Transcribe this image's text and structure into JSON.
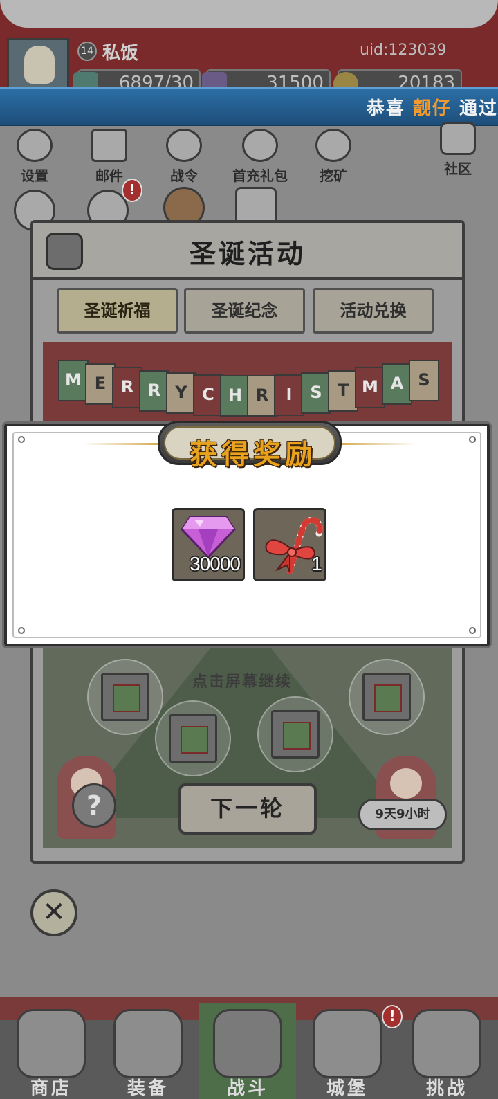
{
  "player": {
    "level": "14",
    "name": "私饭",
    "uid": "uid:123039"
  },
  "resources": [
    {
      "icon": "green-gem-icon",
      "value": "6897/30"
    },
    {
      "icon": "purple-diamond-icon",
      "value": "31500"
    },
    {
      "icon": "gold-coin-icon",
      "value": "20183"
    }
  ],
  "marquee": {
    "prefix": "恭喜",
    "highlight": "靓仔",
    "suffix": "通过",
    "highlight_color": "#f29a2e"
  },
  "top_icons": [
    {
      "icon": "gear-icon",
      "label": "设置"
    },
    {
      "icon": "mail-icon",
      "label": "邮件"
    },
    {
      "icon": "war-order-icon",
      "label": "战令"
    },
    {
      "icon": "first-recharge-gift-icon",
      "label": "首充礼包"
    },
    {
      "icon": "mining-icon",
      "label": "挖矿"
    },
    {
      "icon": "home-icon",
      "label": "社区"
    }
  ],
  "event": {
    "title": "圣诞活动",
    "tabs": [
      {
        "label": "圣诞祈福",
        "active": true
      },
      {
        "label": "圣诞纪念",
        "active": false
      },
      {
        "label": "活动兑换",
        "active": false
      }
    ],
    "banner_letters": [
      "M",
      "E",
      "R",
      "R",
      "Y",
      "C",
      "H",
      "R",
      "I",
      "S",
      "T",
      "M",
      "A",
      "S"
    ],
    "hint": "点击屏幕继续",
    "next_round_label": "下一轮",
    "timer": "9天9小时",
    "question_mark": "?"
  },
  "reward_modal": {
    "title": "获得奖励",
    "items": [
      {
        "icon": "purple-diamond-icon",
        "quantity": "30000"
      },
      {
        "icon": "candy-cane-icon",
        "quantity": "1"
      }
    ]
  },
  "bottom_nav": [
    {
      "icon": "shop-icon",
      "label": "商店",
      "active": false
    },
    {
      "icon": "backpack-icon",
      "label": "装备",
      "active": false
    },
    {
      "icon": "crossed-swords-icon",
      "label": "战斗",
      "active": true
    },
    {
      "icon": "castle-icon",
      "label": "城堡",
      "active": false
    },
    {
      "icon": "shield-icon",
      "label": "挑战",
      "active": false
    }
  ],
  "badges": {
    "notice_icon_badge": "!",
    "castle_badge": "!"
  },
  "close_symbol": "✕"
}
